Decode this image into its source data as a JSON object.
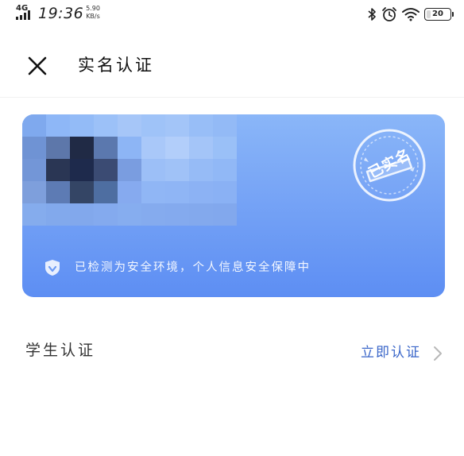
{
  "status_bar": {
    "network": "4G",
    "time": "19:36",
    "speed_value": "5.90",
    "speed_unit": "KB/s",
    "battery": "20",
    "battery_level": 0.2
  },
  "header": {
    "close_icon": "close-icon",
    "title": "实名认证"
  },
  "card": {
    "seal_text": "已实名",
    "safety_text": "已检测为安全环境，个人信息安全保障中",
    "colors": {
      "card_top": "#8ab6f8",
      "card_bottom": "#5d8ef3"
    }
  },
  "student": {
    "label": "学生认证",
    "action": "立即认证"
  },
  "colors": {
    "accent": "#3a66c9",
    "text": "#333333"
  }
}
